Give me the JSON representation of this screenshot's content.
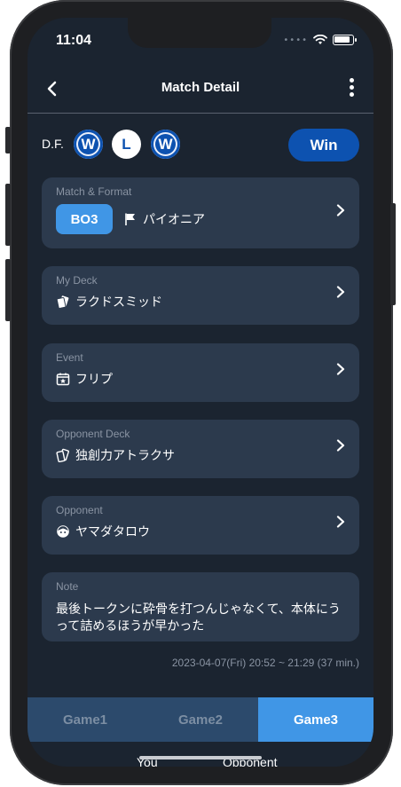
{
  "status": {
    "time": "11:04"
  },
  "nav": {
    "title": "Match Detail"
  },
  "results": {
    "label": "D.F.",
    "games": [
      "W",
      "L",
      "W"
    ],
    "outcome": "Win"
  },
  "cards": {
    "format": {
      "label": "Match & Format",
      "best_of": "BO3",
      "format": "パイオニア"
    },
    "my_deck": {
      "label": "My Deck",
      "value": "ラクドスミッド"
    },
    "event": {
      "label": "Event",
      "value": "フリプ"
    },
    "opponent_deck": {
      "label": "Opponent Deck",
      "value": "独創力アトラクサ"
    },
    "opponent": {
      "label": "Opponent",
      "value": "ヤマダタロウ"
    },
    "note": {
      "label": "Note",
      "value": "最後トークンに砕骨を打つんじゃなくて、本体にうって詰めるほうが早かった"
    }
  },
  "timestamp": "2023-04-07(Fri) 20:52 ~ 21:29 (37 min.)",
  "tabs": [
    "Game1",
    "Game2",
    "Game3"
  ],
  "active_tab": "Game3",
  "bottom": {
    "you": "You",
    "opponent": "Opponent"
  },
  "colors": {
    "background": "#1b2430",
    "card": "#2c3a4d",
    "accent": "#4096e6",
    "win": "#0d52b0"
  }
}
